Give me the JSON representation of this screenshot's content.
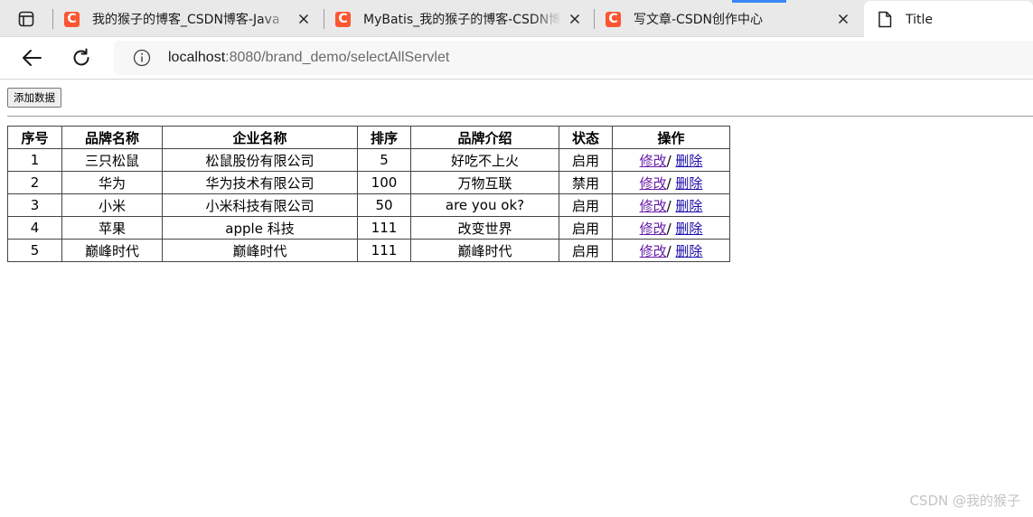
{
  "browser": {
    "tabs": [
      {
        "title": "我的猴子的博客_CSDN博客-Java",
        "favicon": "csdn-icon",
        "active": false
      },
      {
        "title": "MyBatis_我的猴子的博客-CSDN博",
        "favicon": "csdn-icon",
        "active": false
      },
      {
        "title": "写文章-CSDN创作中心",
        "favicon": "csdn-icon",
        "active": false
      },
      {
        "title": "Title",
        "favicon": "page-icon",
        "active": true
      }
    ],
    "url_host": "localhost",
    "url_rest": ":8080/brand_demo/selectAllServlet",
    "accent_color": "#fc5531"
  },
  "page": {
    "add_button_label": "添加数据",
    "table": {
      "headers": [
        "序号",
        "品牌名称",
        "企业名称",
        "排序",
        "品牌介绍",
        "状态",
        "操作"
      ],
      "edit_label": "修改",
      "separator": "/ ",
      "delete_label": "删除",
      "rows": [
        {
          "id": "1",
          "brand": "三只松鼠",
          "company": "松鼠股份有限公司",
          "order": "5",
          "desc": "好吃不上火",
          "status": "启用"
        },
        {
          "id": "2",
          "brand": "华为",
          "company": "华为技术有限公司",
          "order": "100",
          "desc": "万物互联",
          "status": "禁用"
        },
        {
          "id": "3",
          "brand": "小米",
          "company": "小米科技有限公司",
          "order": "50",
          "desc": "are you ok?",
          "status": "启用"
        },
        {
          "id": "4",
          "brand": "苹果",
          "company": "apple 科技",
          "order": "111",
          "desc": "改变世界",
          "status": "启用"
        },
        {
          "id": "5",
          "brand": "巅峰时代",
          "company": "巅峰时代",
          "order": "111",
          "desc": "巅峰时代",
          "status": "启用"
        }
      ]
    },
    "watermark": "CSDN @我的猴子"
  }
}
